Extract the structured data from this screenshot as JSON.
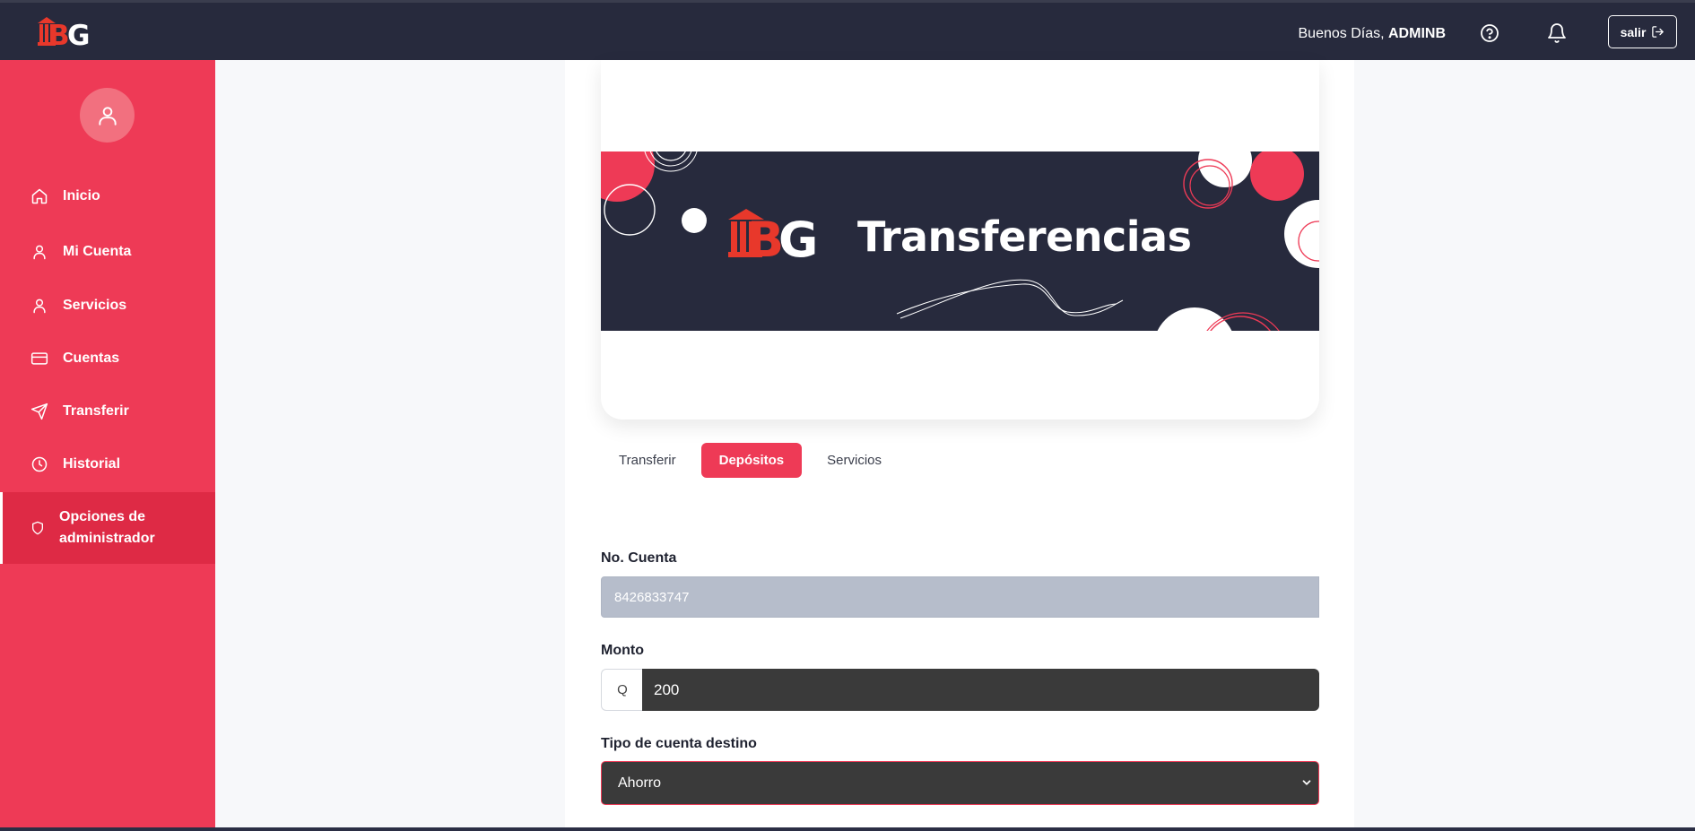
{
  "header": {
    "brand": "IBG",
    "greeting_prefix": "Buenos Días, ",
    "username": "ADMINB",
    "help_icon": "help-circle-icon",
    "bell_icon": "bell-icon",
    "logout_label": "salir",
    "logout_icon": "log-out-icon"
  },
  "sidebar": {
    "avatar_icon": "user-icon",
    "items": [
      {
        "label": "Inicio",
        "icon": "home-icon"
      },
      {
        "label": "Mi Cuenta",
        "icon": "user-icon"
      },
      {
        "label": "Servicios",
        "icon": "user-icon"
      },
      {
        "label": "Cuentas",
        "icon": "credit-card-icon"
      },
      {
        "label": "Transferir",
        "icon": "send-icon"
      },
      {
        "label": "Historial",
        "icon": "clock-icon"
      },
      {
        "label": "Opciones de administrador",
        "icon": "shield-icon",
        "active": true
      }
    ]
  },
  "banner": {
    "title": "Transferencias",
    "logo_text": "IBG"
  },
  "tabs": [
    {
      "label": "Transferir",
      "active": false
    },
    {
      "label": "Depósitos",
      "active": true
    },
    {
      "label": "Servicios",
      "active": false
    }
  ],
  "form": {
    "account_label": "No. Cuenta",
    "account_value": "8426833747",
    "amount_label": "Monto",
    "amount_prefix": "Q",
    "amount_value": "200",
    "dest_type_label": "Tipo de cuenta destino",
    "dest_type_value": "Ahorro"
  },
  "colors": {
    "accent": "#ee3a56",
    "navbar": "#272a3d",
    "sidebar_active": "#de2a45"
  }
}
